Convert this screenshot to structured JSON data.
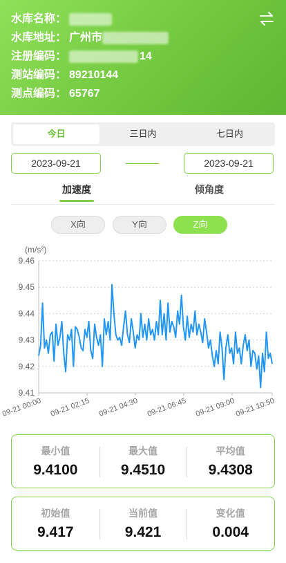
{
  "header": {
    "fields": [
      {
        "label": "水库名称：",
        "value": ""
      },
      {
        "label": "水库地址：",
        "value": "广州市"
      },
      {
        "label": "注册编码：",
        "value": "14"
      },
      {
        "label": "测站编码：",
        "value": "89210144"
      },
      {
        "label": "测点编码：",
        "value": "65767"
      }
    ],
    "swap_icon": "swap-arrows-icon"
  },
  "range_tabs": [
    "今日",
    "三日内",
    "七日内"
  ],
  "range_active": "今日",
  "dates": {
    "start": "2023-09-21",
    "end": "2023-09-21"
  },
  "main_tabs": {
    "accel": "加速度",
    "tilt": "倾角度"
  },
  "axis_tabs": {
    "x": "X向",
    "y": "Y向",
    "z": "Z向",
    "active": "Z向"
  },
  "colors": {
    "accent": "#7ed04a",
    "line": "#2196f3"
  },
  "chart_data": {
    "type": "line",
    "title": "",
    "ylabel": "(m/s²)",
    "ylim": [
      9.41,
      9.46
    ],
    "yticks": [
      "9.46",
      "9.45",
      "9.44",
      "9.43",
      "9.42",
      "9.41"
    ],
    "xticks": [
      "09-21 00:00",
      "09-21 02:15",
      "09-21 04:30",
      "09-21 06:45",
      "09-21 09:00",
      "09-21 10:50"
    ],
    "x_range_minutes": [
      0,
      650
    ],
    "grid": true,
    "series": [
      {
        "name": "",
        "values": [
          9.424,
          9.428,
          9.444,
          9.427,
          9.43,
          9.425,
          9.432,
          9.433,
          9.422,
          9.436,
          9.428,
          9.431,
          9.437,
          9.425,
          9.418,
          9.432,
          9.43,
          9.434,
          9.42,
          9.435,
          9.434,
          9.431,
          9.427,
          9.426,
          9.434,
          9.431,
          9.437,
          9.426,
          9.423,
          9.436,
          9.431,
          9.428,
          9.432,
          9.42,
          9.438,
          9.432,
          9.437,
          9.43,
          9.451,
          9.44,
          9.432,
          9.43,
          9.431,
          9.428,
          9.435,
          9.441,
          9.432,
          9.429,
          9.438,
          9.433,
          9.427,
          9.432,
          9.43,
          9.44,
          9.431,
          9.436,
          9.43,
          9.438,
          9.432,
          9.434,
          9.43,
          9.437,
          9.432,
          9.445,
          9.432,
          9.44,
          9.43,
          9.444,
          9.433,
          9.437,
          9.435,
          9.431,
          9.441,
          9.436,
          9.447,
          9.435,
          9.43,
          9.439,
          9.431,
          9.436,
          9.433,
          9.441,
          9.432,
          9.436,
          9.433,
          9.429,
          9.438,
          9.433,
          9.427,
          9.43,
          9.424,
          9.42,
          9.426,
          9.421,
          9.433,
          9.427,
          9.415,
          9.427,
          9.432,
          9.425,
          9.427,
          9.421,
          9.433,
          9.425,
          9.427,
          9.421,
          9.428,
          9.432,
          9.426,
          9.43,
          9.42,
          9.426,
          9.425,
          9.419,
          9.424,
          9.412,
          9.425,
          9.418,
          9.433,
          9.423,
          9.425,
          9.421
        ]
      }
    ]
  },
  "stats_top": [
    {
      "label": "最小值",
      "value": "9.4100"
    },
    {
      "label": "最大值",
      "value": "9.4510"
    },
    {
      "label": "平均值",
      "value": "9.4308"
    }
  ],
  "stats_bottom": [
    {
      "label": "初始值",
      "value": "9.417"
    },
    {
      "label": "当前值",
      "value": "9.421"
    },
    {
      "label": "变化值",
      "value": "0.004"
    }
  ]
}
